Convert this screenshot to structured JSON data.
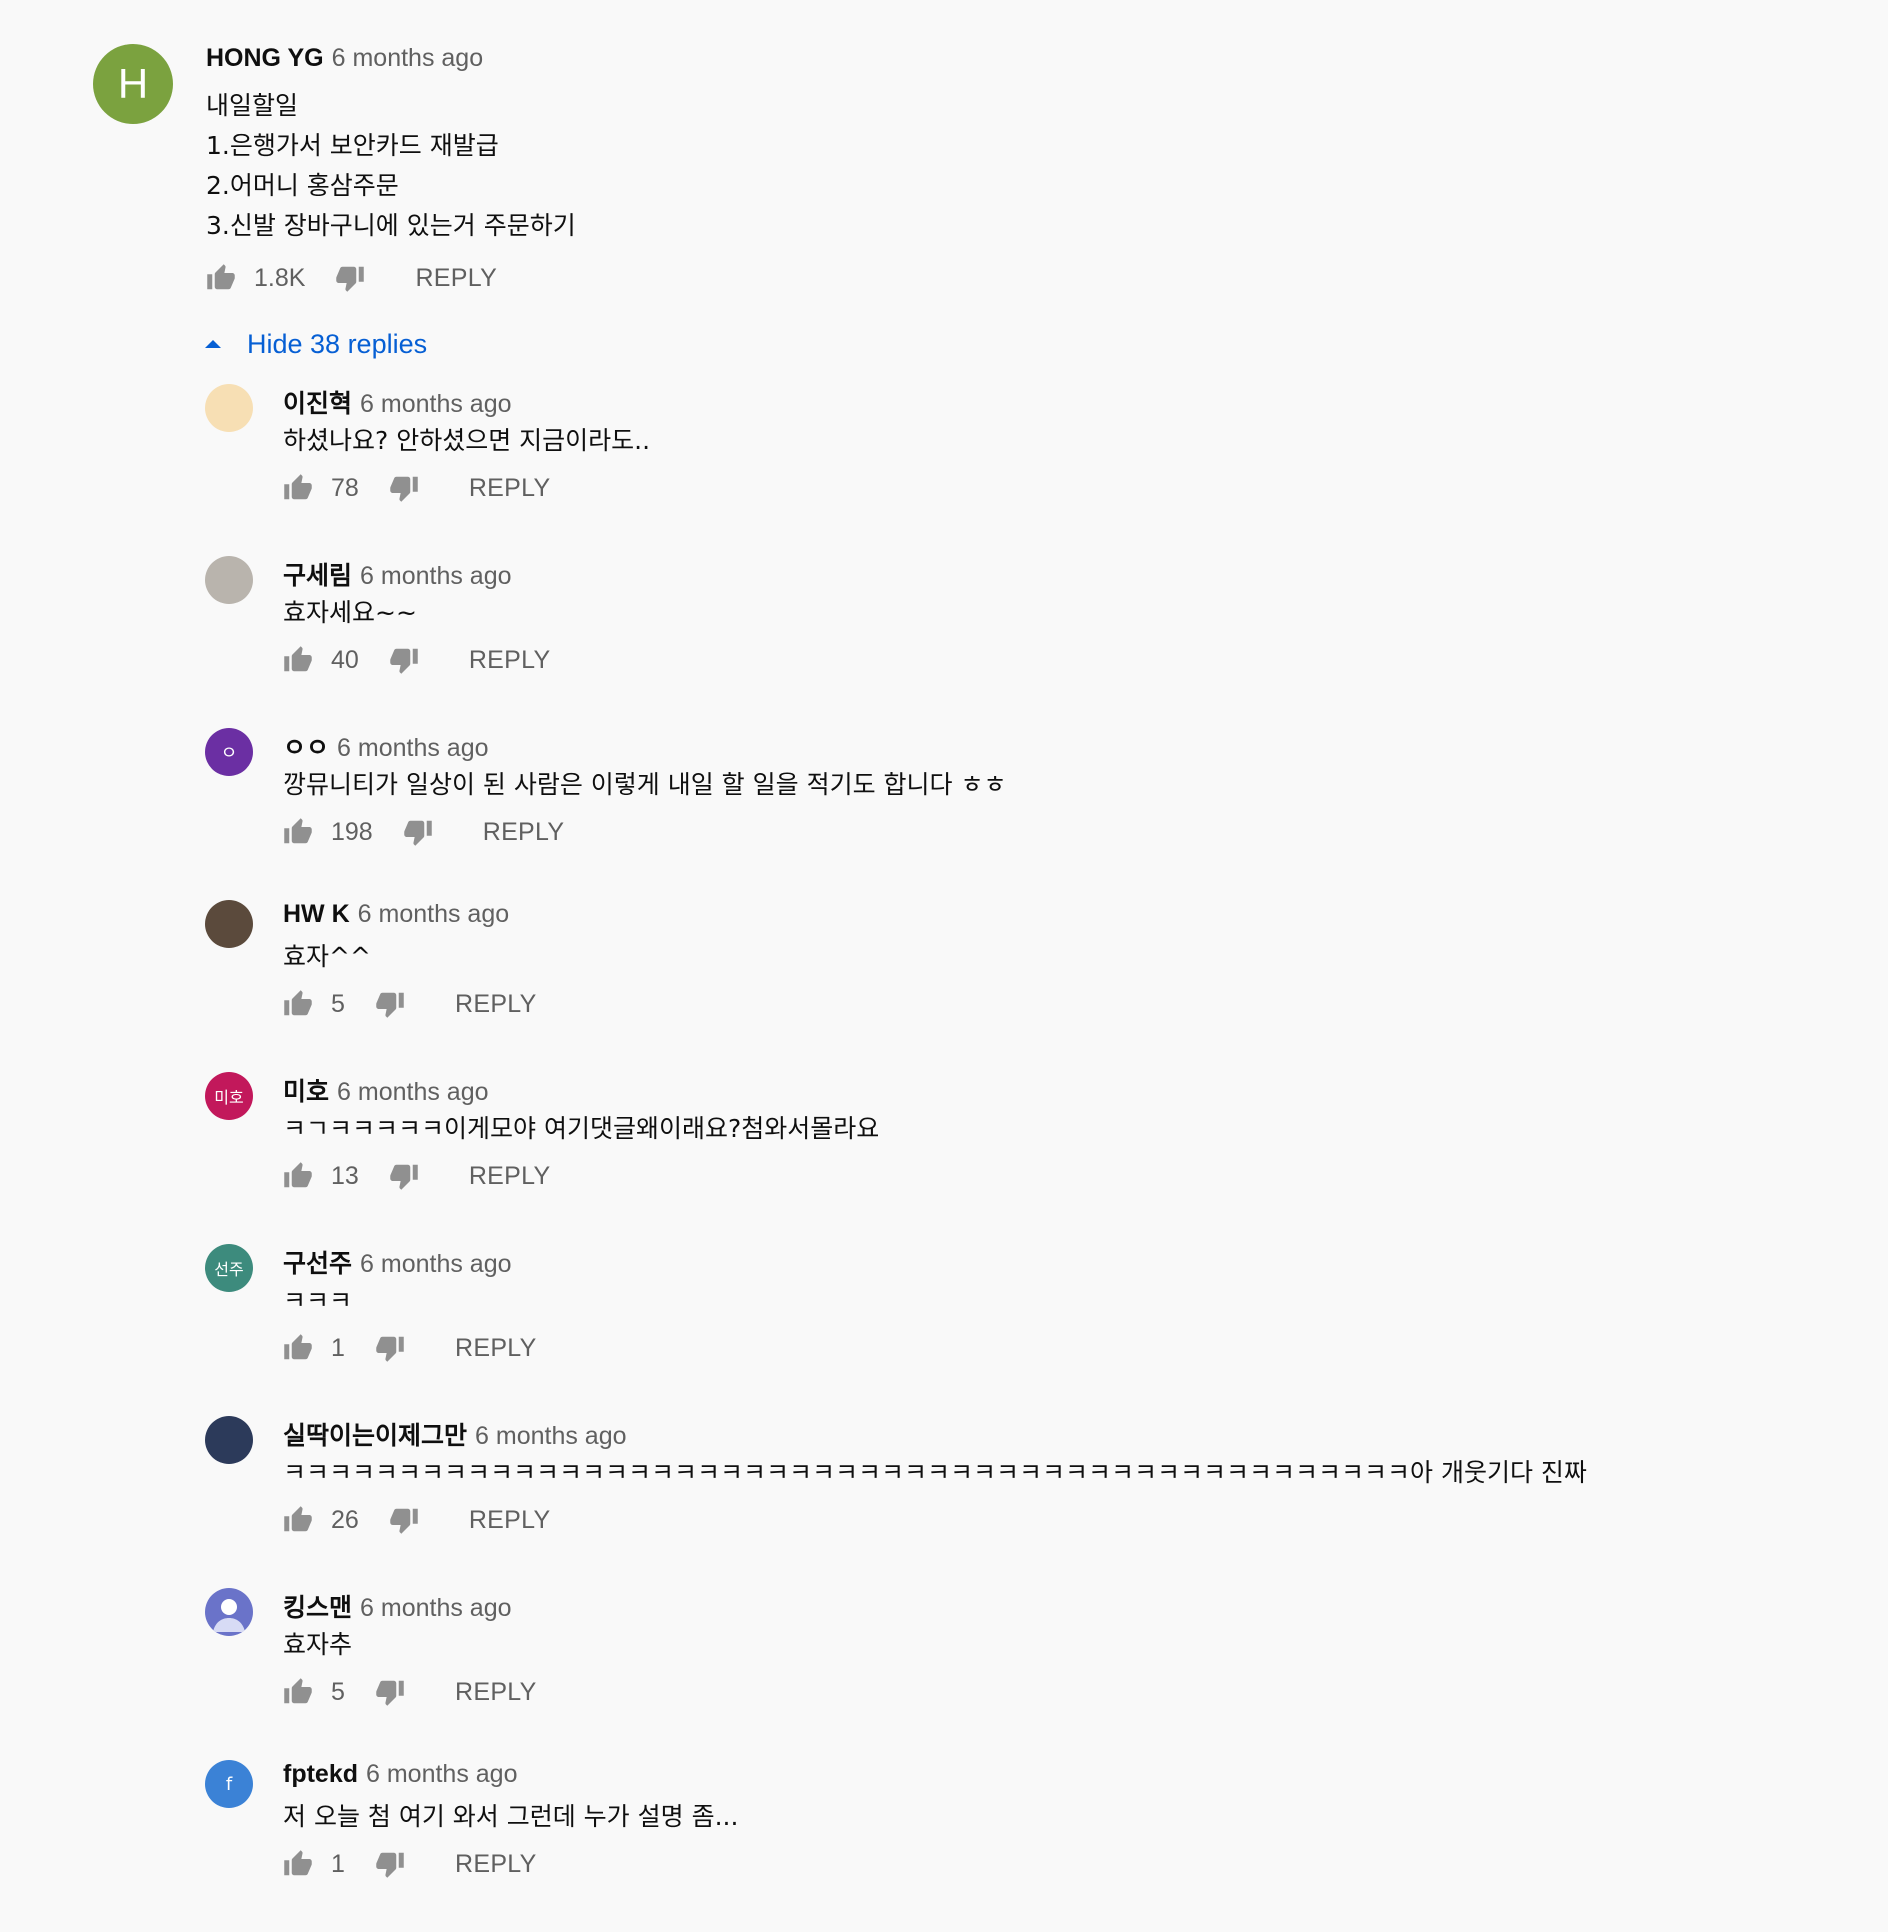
{
  "top_comment": {
    "author": "HONG YG",
    "time": "6 months ago",
    "avatar_letter": "H",
    "avatar_color": "#7ba23f",
    "text": "내일할일\n1.은행가서 보안카드 재발급\n2.어머니 홍삼주문\n3.신발 장바구니에 있는거 주문하기",
    "likes": "1.8K",
    "reply_label": "REPLY"
  },
  "toggle_label": "Hide 38 replies",
  "replies": [
    {
      "author": "이진혁",
      "time": "6 months ago",
      "text": "하셨나요? 안하셨으면 지금이라도..",
      "likes": "78",
      "avatar_letter": "",
      "avatar_color": "#f7dfb4",
      "avatar_icon": "dog-image",
      "reply_label": "REPLY"
    },
    {
      "author": "구세림",
      "time": "6 months ago",
      "text": "효자세요~~",
      "likes": "40",
      "avatar_letter": "",
      "avatar_color": "#b9b4ad",
      "avatar_icon": "cat-photo",
      "reply_label": "REPLY"
    },
    {
      "author": "ㅇㅇ",
      "time": "6 months ago",
      "text": "깡뮤니티가 일상이 된 사람은 이렇게 내일 할 일을 적기도 합니다 ㅎㅎ",
      "likes": "198",
      "avatar_letter": "ㅇ",
      "avatar_color": "#6b2fa3",
      "avatar_icon": "",
      "reply_label": "REPLY"
    },
    {
      "author": "HW K",
      "time": "6 months ago",
      "text": "효자^^",
      "likes": "5",
      "avatar_letter": "",
      "avatar_color": "#5b4a3c",
      "avatar_icon": "person-photo",
      "reply_label": "REPLY"
    },
    {
      "author": "미호",
      "time": "6 months ago",
      "text": "ㅋㄱㅋㅋㅋㅋㅋ이게모야 여기댓글왜이래요?첨와서몰라요",
      "likes": "13",
      "avatar_letter": "미호",
      "avatar_color": "#c2185b",
      "avatar_icon": "",
      "reply_label": "REPLY"
    },
    {
      "author": "구선주",
      "time": "6 months ago",
      "text": "ㅋㅋㅋ",
      "likes": "1",
      "avatar_letter": "선주",
      "avatar_color": "#3d8b7d",
      "avatar_icon": "",
      "reply_label": "REPLY"
    },
    {
      "author": "실딱이는이제그만",
      "time": "6 months ago",
      "text": "ㅋㅋㅋㅋㅋㅋㅋㅋㅋㅋㅋㅋㅋㅋㅋㅋㅋㅋㅋㅋㅋㅋㅋㅋㅋㅋㅋㅋㅋㅋㅋㅋㅋㅋㅋㅋㅋㅋㅋㅋㅋㅋㅋㅋㅋㅋㅋㅋㅋ아 개웃기다 진짜",
      "likes": "26",
      "avatar_letter": "",
      "avatar_color": "#2c3a5a",
      "avatar_icon": "night-sky-photo",
      "reply_label": "REPLY"
    },
    {
      "author": "킹스맨",
      "time": "6 months ago",
      "text": "효자추",
      "likes": "5",
      "avatar_letter": "",
      "avatar_color": "#6a73c9",
      "avatar_icon": "default-user-icon",
      "reply_label": "REPLY"
    },
    {
      "author": "fptekd",
      "time": "6 months ago",
      "text": "저 오늘 첨 여기 와서 그런데 누가 설명 좀...",
      "likes": "1",
      "avatar_letter": "f",
      "avatar_color": "#3b82d6",
      "avatar_icon": "",
      "reply_label": "REPLY"
    }
  ]
}
